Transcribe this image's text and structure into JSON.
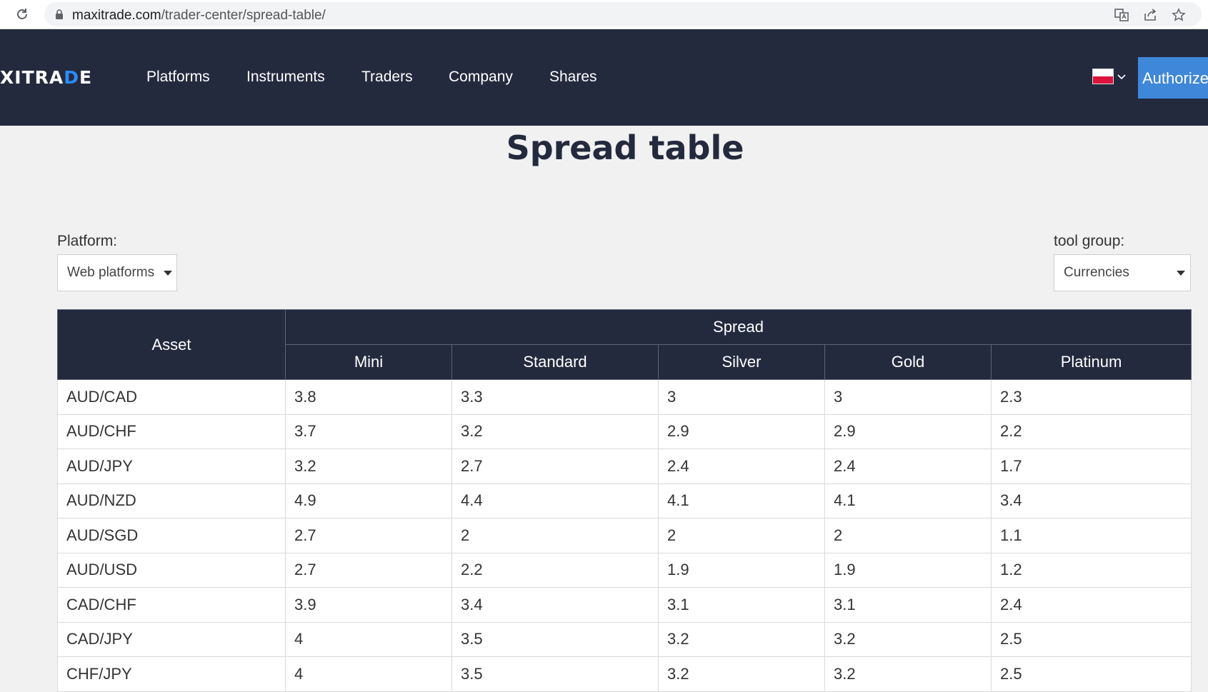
{
  "browser": {
    "url_host": "maxitrade.com",
    "url_path": "/trader-center/spread-table/"
  },
  "header": {
    "logo_main": "XITRA",
    "logo_accent": "D",
    "logo_end": "E",
    "nav": [
      "Platforms",
      "Instruments",
      "Traders",
      "Company",
      "Shares"
    ],
    "authorize_label": "Authorize"
  },
  "page": {
    "title": "Spread table"
  },
  "filters": {
    "platform_label": "Platform:",
    "platform_value": "Web platforms",
    "tool_group_label": "tool group:",
    "tool_group_value": "Currencies"
  },
  "table": {
    "asset_header": "Asset",
    "group_header": "Spread",
    "columns": [
      "Mini",
      "Standard",
      "Silver",
      "Gold",
      "Platinum"
    ],
    "rows": [
      [
        "AUD/CAD",
        "3.8",
        "3.3",
        "3",
        "3",
        "2.3"
      ],
      [
        "AUD/CHF",
        "3.7",
        "3.2",
        "2.9",
        "2.9",
        "2.2"
      ],
      [
        "AUD/JPY",
        "3.2",
        "2.7",
        "2.4",
        "2.4",
        "1.7"
      ],
      [
        "AUD/NZD",
        "4.9",
        "4.4",
        "4.1",
        "4.1",
        "3.4"
      ],
      [
        "AUD/SGD",
        "2.7",
        "2",
        "2",
        "2",
        "1.1"
      ],
      [
        "AUD/USD",
        "2.7",
        "2.2",
        "1.9",
        "1.9",
        "1.2"
      ],
      [
        "CAD/CHF",
        "3.9",
        "3.4",
        "3.1",
        "3.1",
        "2.4"
      ],
      [
        "CAD/JPY",
        "4",
        "3.5",
        "3.2",
        "3.2",
        "2.5"
      ],
      [
        "CHF/JPY",
        "4",
        "3.5",
        "3.2",
        "3.2",
        "2.5"
      ]
    ]
  }
}
